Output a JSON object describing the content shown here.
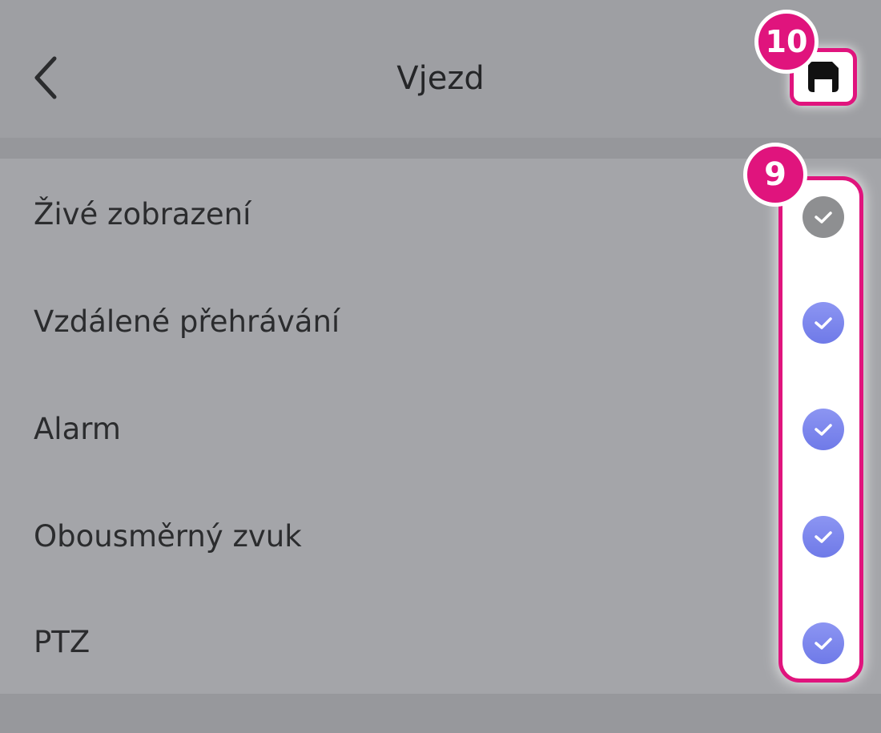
{
  "header": {
    "title": "Vjezd",
    "back_icon": "chevron-left-icon",
    "save_icon": "floppy-disk-icon"
  },
  "callouts": {
    "save": "10",
    "checks": "9"
  },
  "permissions": [
    {
      "label": "Živé zobrazení",
      "checked": true,
      "disabled": true
    },
    {
      "label": "Vzdálené přehrávání",
      "checked": true,
      "disabled": false
    },
    {
      "label": "Alarm",
      "checked": true,
      "disabled": false
    },
    {
      "label": "Obousměrný zvuk",
      "checked": true,
      "disabled": false
    },
    {
      "label": "PTZ",
      "checked": true,
      "disabled": false
    }
  ],
  "colors": {
    "accent": "#7a83ee",
    "callout": "#e0147d",
    "disabled": "#8e8f91"
  }
}
